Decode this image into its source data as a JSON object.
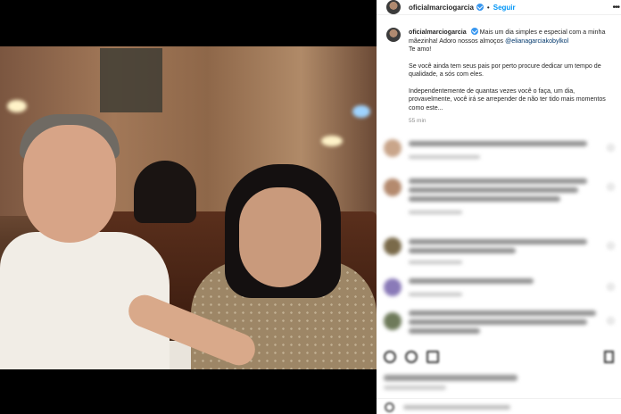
{
  "post": {
    "username": "oficialmarciogarcia",
    "follow_label": "Seguir",
    "separator": "•",
    "more_label": "•••"
  },
  "caption": {
    "username": "oficialmarciogarcia",
    "line1": "Mais um dia simples e especial com a minha mãezinha! Adoro nossos almoços",
    "mention": "@elianagarciakobylkol",
    "line1_end": "Te amo!",
    "para2": "Se você ainda tem seus pais por perto procure dedicar um tempo de qualidade, a sós com eles.",
    "para3": "Independentemente de quantas vezes você o faça, um dia, provavelmente, você irá se arrepender de não ter tido mais momentos como este...",
    "time": "55 min"
  },
  "colors": {
    "link_blue": "#0095f6",
    "mention_blue": "#00376b",
    "verified_blue": "#3897f0"
  },
  "icons": [
    "more-icon",
    "verified-icon",
    "heart-icon",
    "comment-icon",
    "share-icon",
    "save-icon",
    "emoji-icon"
  ]
}
